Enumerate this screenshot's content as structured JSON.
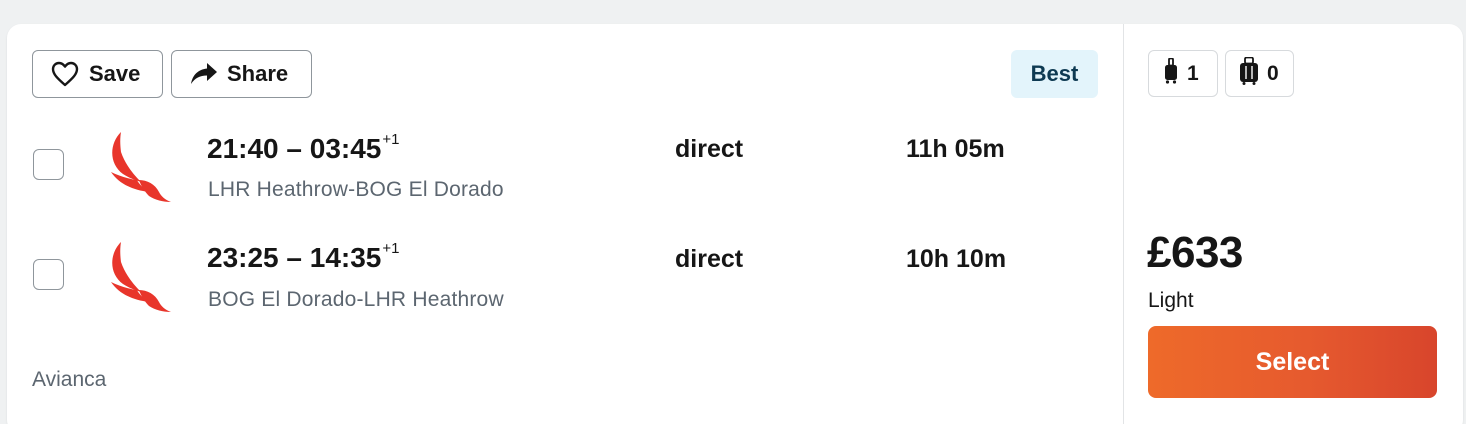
{
  "actions": {
    "save_label": "Save",
    "share_label": "Share"
  },
  "tag": "Best",
  "flights": [
    {
      "departure": "21:40",
      "arrival": "03:45",
      "day_offset": "+1",
      "route": "LHR Heathrow-BOG El Dorado",
      "stops": "direct",
      "duration": "11h 05m"
    },
    {
      "departure": "23:25",
      "arrival": "14:35",
      "day_offset": "+1",
      "route": "BOG El Dorado-LHR Heathrow",
      "stops": "direct",
      "duration": "10h 10m"
    }
  ],
  "time_separator": " – ",
  "airline": "Avianca",
  "baggage": {
    "cabin_count": "1",
    "checked_count": "0"
  },
  "price": "£633",
  "fare_type": "Light",
  "select_label": "Select",
  "colors": {
    "accent_start": "#ee6a2a",
    "accent_end": "#d8452c",
    "best_badge_bg": "#e3f4fb",
    "airline_red": "#e8352b"
  },
  "icons": {
    "save": "heart-icon",
    "share": "share-arrow-icon",
    "cabin_bag": "cabin-bag-icon",
    "checked_bag": "checked-bag-icon",
    "airline_logo": "avianca-logo"
  }
}
